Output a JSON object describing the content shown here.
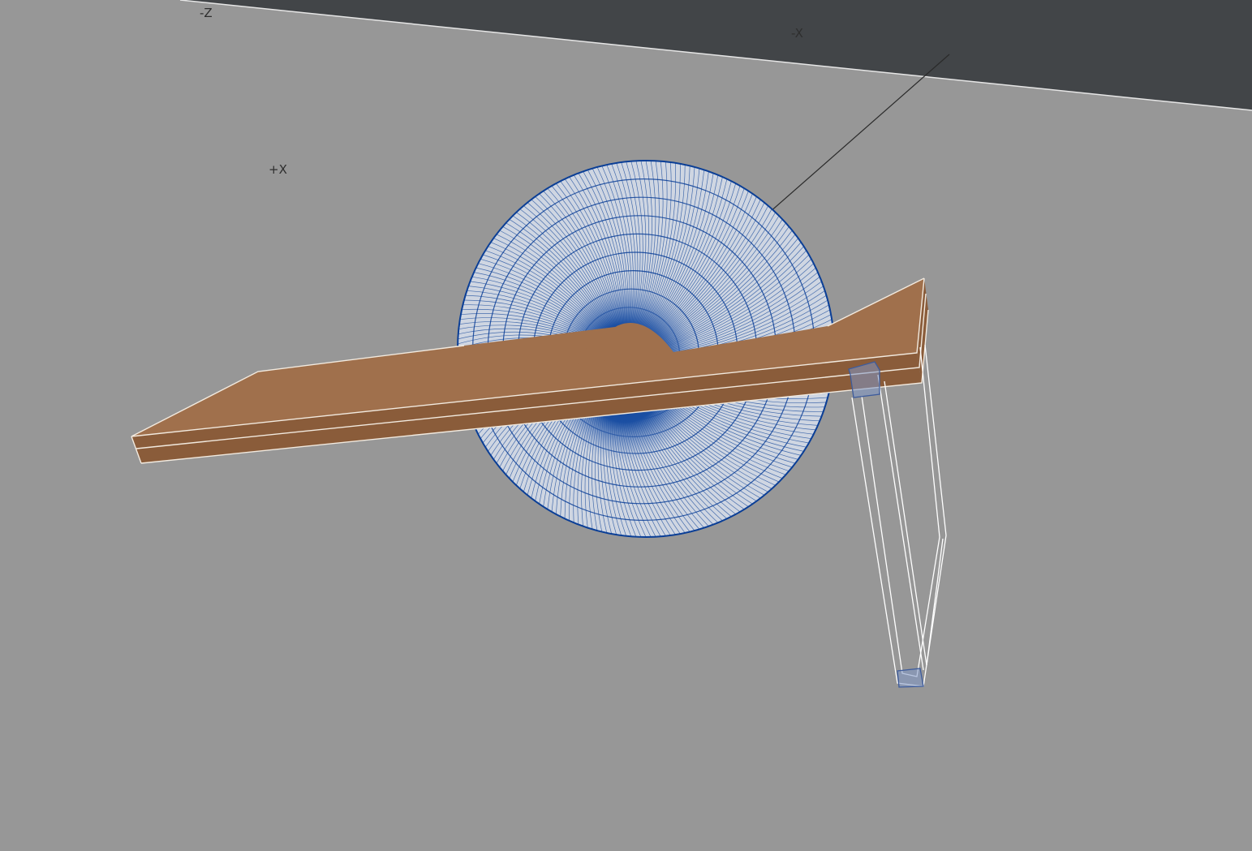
{
  "viewport": {
    "background_color": "#979797",
    "sky_color": "#424548"
  },
  "axis_labels": {
    "neg_z": "-Z",
    "neg_x": "-X",
    "pos_x": "+X"
  },
  "objects": {
    "torus": {
      "wire_color": "#0a3e96",
      "fill_color": "#cfd6e2"
    },
    "plank": {
      "top_color": "#a0704c",
      "side_color": "#8a5c3a",
      "edge_color": "#f2eadf"
    },
    "frame": {
      "edge_color": "#ffffff",
      "cap_color": "#7f97c6",
      "cap_edge_color": "#3e5c9c"
    }
  }
}
